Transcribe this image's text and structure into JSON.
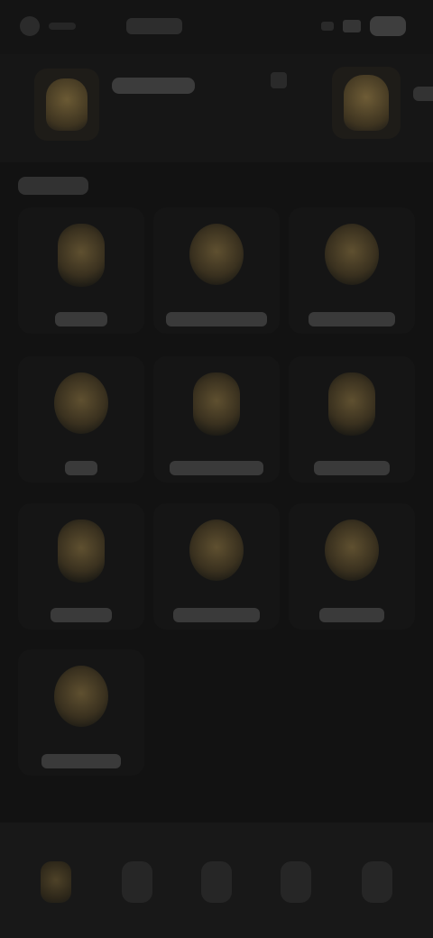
{
  "status_bar": {
    "time": "",
    "carrier": ""
  },
  "header": {
    "account_name": "",
    "side_label": ""
  },
  "section": {
    "title": ""
  },
  "tiles": [
    {
      "label": "",
      "icon": "bottle-icon"
    },
    {
      "label": "",
      "icon": "badge-icon"
    },
    {
      "label": "",
      "icon": "badge-icon"
    },
    {
      "label": "",
      "icon": "shield-icon"
    },
    {
      "label": "",
      "icon": "bottle-icon"
    },
    {
      "label": "",
      "icon": "badge-icon"
    },
    {
      "label": "",
      "icon": "cup-icon"
    },
    {
      "label": "",
      "icon": "badge-icon"
    },
    {
      "label": "",
      "icon": "badge-icon"
    },
    {
      "label": "",
      "icon": "badge-icon"
    }
  ],
  "bottom_nav": [
    {
      "label": "",
      "icon": "home-icon",
      "active": true
    },
    {
      "label": "",
      "icon": "grid-icon",
      "active": false
    },
    {
      "label": "",
      "icon": "search-icon",
      "active": false
    },
    {
      "label": "",
      "icon": "chat-icon",
      "active": false
    },
    {
      "label": "",
      "icon": "profile-icon",
      "active": false
    }
  ],
  "colors": {
    "background": "#121212",
    "accent_gold": "#6b5a34"
  }
}
